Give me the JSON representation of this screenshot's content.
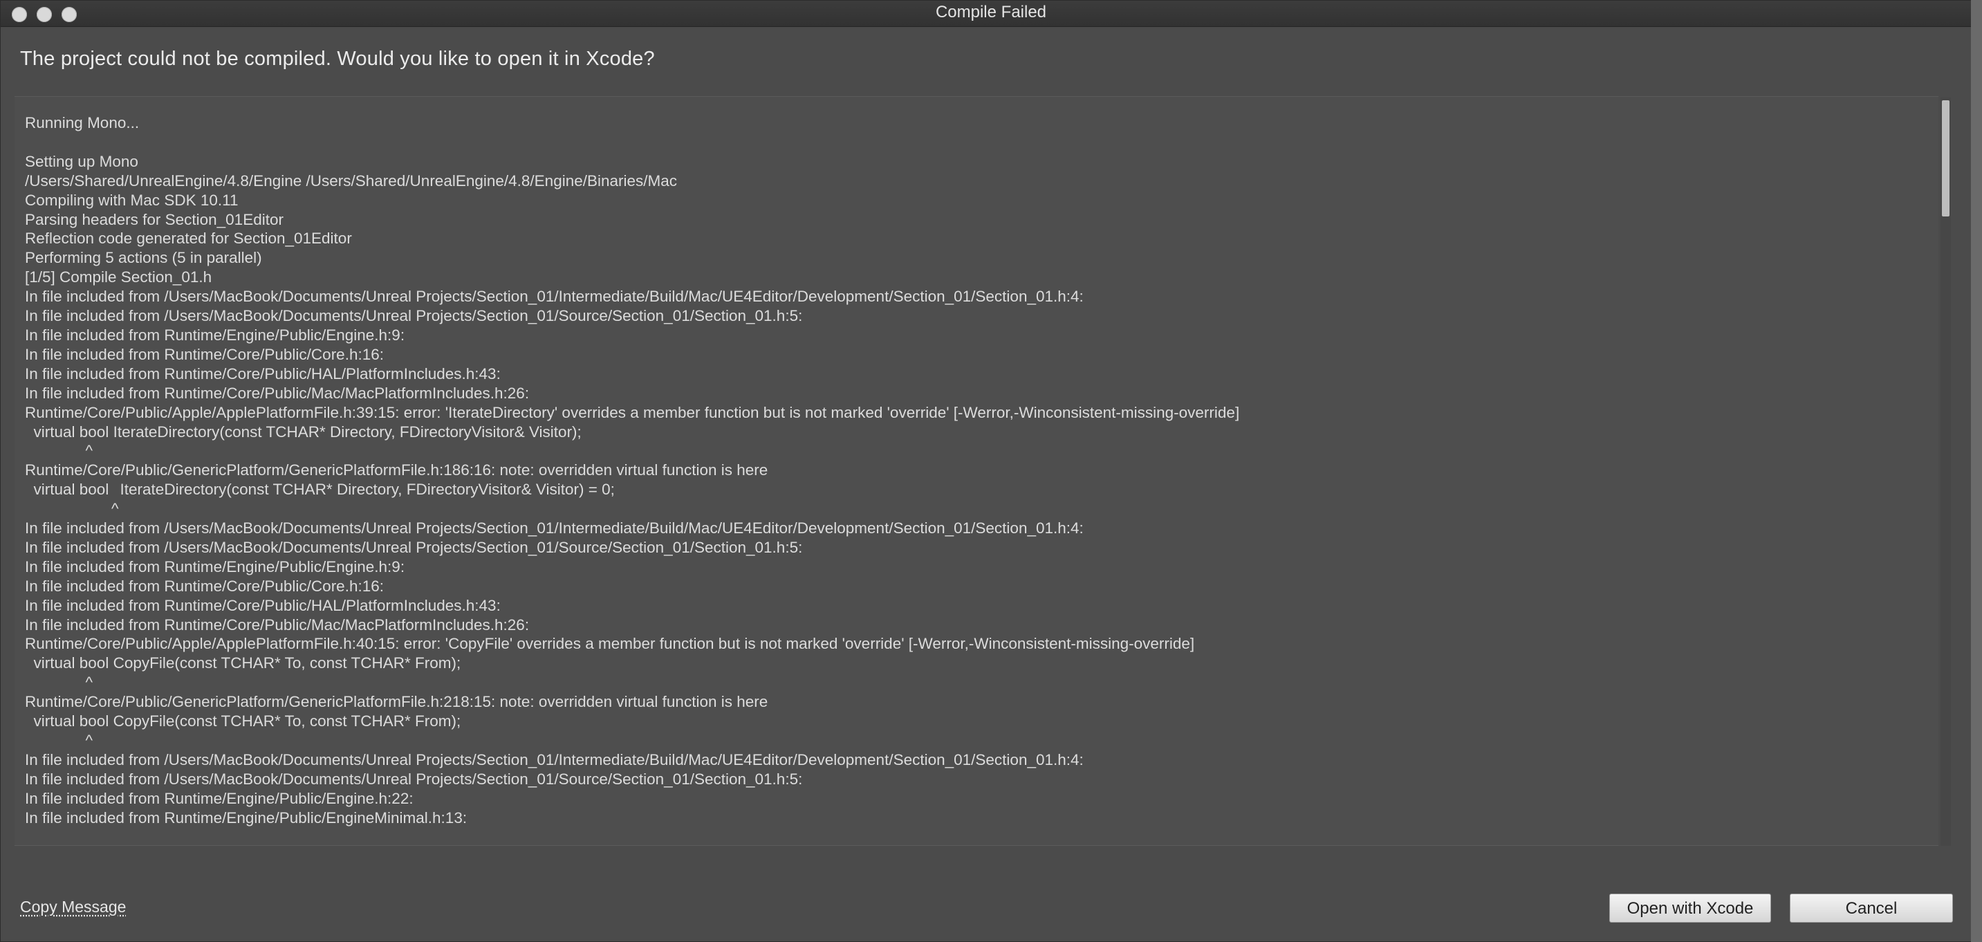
{
  "window": {
    "title": "Compile Failed"
  },
  "dialog": {
    "prompt": "The project could not be compiled. Would you like to open it in Xcode?",
    "log_lines": [
      "Running Mono...",
      "",
      "Setting up Mono",
      "/Users/Shared/UnrealEngine/4.8/Engine /Users/Shared/UnrealEngine/4.8/Engine/Binaries/Mac",
      "Compiling with Mac SDK 10.11",
      "Parsing headers for Section_01Editor",
      "Reflection code generated for Section_01Editor",
      "Performing 5 actions (5 in parallel)",
      "[1/5] Compile Section_01.h",
      "In file included from /Users/MacBook/Documents/Unreal Projects/Section_01/Intermediate/Build/Mac/UE4Editor/Development/Section_01/Section_01.h:4:",
      "In file included from /Users/MacBook/Documents/Unreal Projects/Section_01/Source/Section_01/Section_01.h:5:",
      "In file included from Runtime/Engine/Public/Engine.h:9:",
      "In file included from Runtime/Core/Public/Core.h:16:",
      "In file included from Runtime/Core/Public/HAL/PlatformIncludes.h:43:",
      "In file included from Runtime/Core/Public/Mac/MacPlatformIncludes.h:26:",
      "Runtime/Core/Public/Apple/ApplePlatformFile.h:39:15: error: 'IterateDirectory' overrides a member function but is not marked 'override' [-Werror,-Winconsistent-missing-override]",
      "\tvirtual bool IterateDirectory(const TCHAR* Directory, FDirectoryVisitor& Visitor);",
      "\t            ^",
      "Runtime/Core/Public/GenericPlatform/GenericPlatformFile.h:186:16: note: overridden virtual function is here",
      "\tvirtual bool\t\tIterateDirectory(const TCHAR* Directory, FDirectoryVisitor& Visitor) = 0;",
      "\t                  ^",
      "In file included from /Users/MacBook/Documents/Unreal Projects/Section_01/Intermediate/Build/Mac/UE4Editor/Development/Section_01/Section_01.h:4:",
      "In file included from /Users/MacBook/Documents/Unreal Projects/Section_01/Source/Section_01/Section_01.h:5:",
      "In file included from Runtime/Engine/Public/Engine.h:9:",
      "In file included from Runtime/Core/Public/Core.h:16:",
      "In file included from Runtime/Core/Public/HAL/PlatformIncludes.h:43:",
      "In file included from Runtime/Core/Public/Mac/MacPlatformIncludes.h:26:",
      "Runtime/Core/Public/Apple/ApplePlatformFile.h:40:15: error: 'CopyFile' overrides a member function but is not marked 'override' [-Werror,-Winconsistent-missing-override]",
      "\tvirtual bool CopyFile(const TCHAR* To, const TCHAR* From);",
      "\t            ^",
      "Runtime/Core/Public/GenericPlatform/GenericPlatformFile.h:218:15: note: overridden virtual function is here",
      "\tvirtual bool CopyFile(const TCHAR* To, const TCHAR* From);",
      "\t            ^",
      "In file included from /Users/MacBook/Documents/Unreal Projects/Section_01/Intermediate/Build/Mac/UE4Editor/Development/Section_01/Section_01.h:4:",
      "In file included from /Users/MacBook/Documents/Unreal Projects/Section_01/Source/Section_01/Section_01.h:5:",
      "In file included from Runtime/Engine/Public/Engine.h:22:",
      "In file included from Runtime/Engine/Public/EngineMinimal.h:13:"
    ],
    "copy_message_label": "Copy Message",
    "open_xcode_label": "Open with Xcode",
    "cancel_label": "Cancel"
  },
  "colors": {
    "background": "#4b4b4b",
    "titlebar": "#353535",
    "text": "#dcdcdc",
    "button_face": "#e4e4e4"
  },
  "icons": [
    "close-dot-icon",
    "minimize-dot-icon",
    "zoom-dot-icon"
  ]
}
